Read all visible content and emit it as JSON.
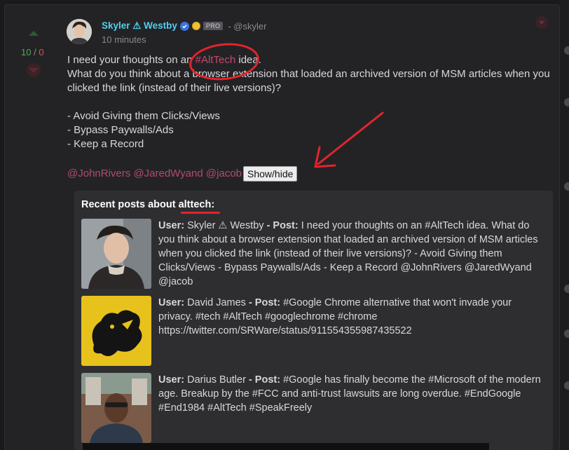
{
  "post": {
    "display_name": "Skyler ⚠ Westby",
    "pro_label": "PRO",
    "handle": "- @skyler",
    "timestamp": "10 minutes",
    "score_up": "10",
    "score_sep": "/",
    "score_down": "0",
    "line1_pre": "I need your thoughts on an ",
    "line1_tag": "#AltTech",
    "line1_post": " idea.",
    "line2": "What do you think about a browser extension that loaded an archived version of MSM articles when you clicked the link (instead of their live versions)?",
    "bullets": [
      "- Avoid Giving them Clicks/Views",
      "- Bypass Paywalls/Ads",
      "- Keep a Record"
    ],
    "mentions": [
      "@JohnRivers",
      "@JaredWyand",
      "@jacob"
    ],
    "toggle_label": "Show/hide"
  },
  "recent": {
    "title_prefix": "Recent posts about ",
    "keyword": "alttech",
    "title_suffix": ":",
    "user_label": "User:",
    "post_label": "- Post:",
    "entries": [
      {
        "user": "Skyler ⚠ Westby",
        "post": "I need your thoughts on an #AltTech idea. What do you think about a browser extension that loaded an archived version of MSM articles when you clicked the link (instead of their live versions)? - Avoid Giving them Clicks/Views - Bypass Paywalls/Ads - Keep a Record @JohnRivers @JaredWyand @jacob"
      },
      {
        "user": "David James",
        "post": "#Google Chrome alternative that won't invade your privacy. #tech #AltTech #googlechrome #chrome https://twitter.com/SRWare/status/911554355987435522"
      },
      {
        "user": "Darius Butler",
        "post": "#Google has finally become the #Microsoft of the modern age. Breakup by the #FCC and anti-trust lawsuits are long overdue. #EndGoogle #End1984 #AltTech #SpeakFreely"
      }
    ]
  },
  "colors": {
    "name": "#4fd0f0",
    "hashtag": "#c04a6e",
    "upvote": "#4caf50",
    "downvote": "#d9534f",
    "annotation": "#e3242b"
  },
  "icons": [
    "upvote-arrow-icon",
    "downvote-arrow-icon",
    "verified-check-icon",
    "gold-badge-icon",
    "post-menu-chevron-icon"
  ]
}
